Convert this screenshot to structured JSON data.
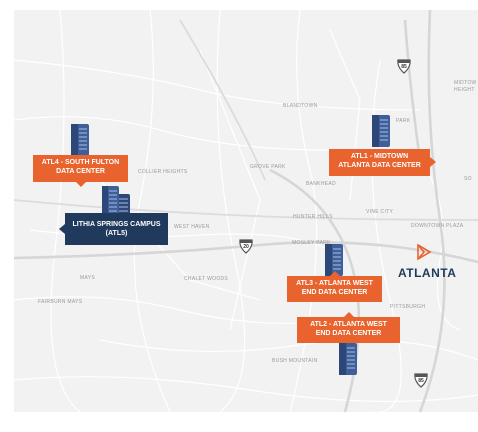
{
  "places": {
    "blandtown": "BLANDTOWN",
    "park": "PARK",
    "midtown_heights": "MIDTOW HEIGHT",
    "collier_heights": "COLLIER HEIGHTS",
    "grove_park": "GROVE PARK",
    "bankhead": "BANKHEAD",
    "so": "SO",
    "vine_city": "VINE CITY",
    "hunter_hills": "HUNTER HILLS",
    "downtown_plaza": "DOWNTOWN PLAZA",
    "west_haven": "WEST HAVEN",
    "mosley_park": "MOSLEY PARK",
    "mays": "MAYS",
    "chalet_woods": "CHALET WOODS",
    "fairburn_mays": "FAIRBURN MAYS",
    "pittsburgh": "PITTSBURGH",
    "bush_mountain": "BUSH MOUNTAIN"
  },
  "shields": {
    "i85_north": "85",
    "i20": "20",
    "i85_south": "85"
  },
  "locations": {
    "atl1": "ATL1 - MIDTOWN ATLANTA DATA CENTER",
    "atl4": "ATL4 - SOUTH FULTON DATA CENTER",
    "atl5": "LITHIA SPRINGS CAMPUS (ATL5)",
    "atl3": "ATL3 - ATLANTA WEST END DATA CENTER",
    "atl2": "ATL2 - ATLANTA WEST END DATA CENTER"
  },
  "brand": {
    "city": "ATLANTA"
  },
  "colors": {
    "orange": "#e8632e",
    "navy": "#1f3a5c",
    "building": "#3f5f9a"
  }
}
